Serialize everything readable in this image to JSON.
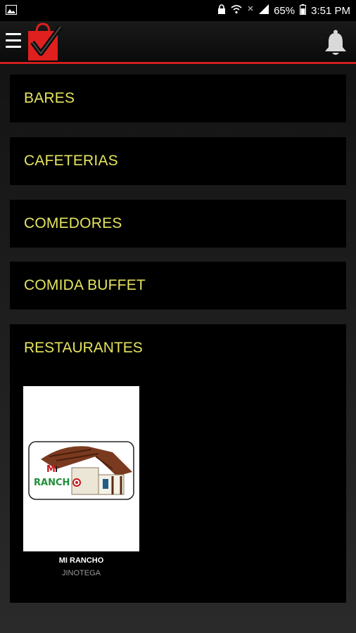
{
  "status_bar": {
    "battery": "65%",
    "time": "3:51 PM"
  },
  "app_bar": {
    "menu_icon": "hamburger-menu-icon",
    "logo": "shopping-bag-checkmark-logo",
    "notification_icon": "bell-icon",
    "accent_color": "#d11d1d"
  },
  "categories": [
    {
      "label": "BARES"
    },
    {
      "label": "CAFETERIAS"
    },
    {
      "label": "COMEDORES"
    },
    {
      "label": "COMIDA BUFFET"
    }
  ],
  "restaurants_section": {
    "title": "RESTAURANTES",
    "listings": [
      {
        "name": "MI RANCHO",
        "city": "JINOTEGA",
        "logo_text": "MI RANCHO"
      }
    ]
  },
  "colors": {
    "category_text": "#e5e45e",
    "card_background": "#000000"
  }
}
